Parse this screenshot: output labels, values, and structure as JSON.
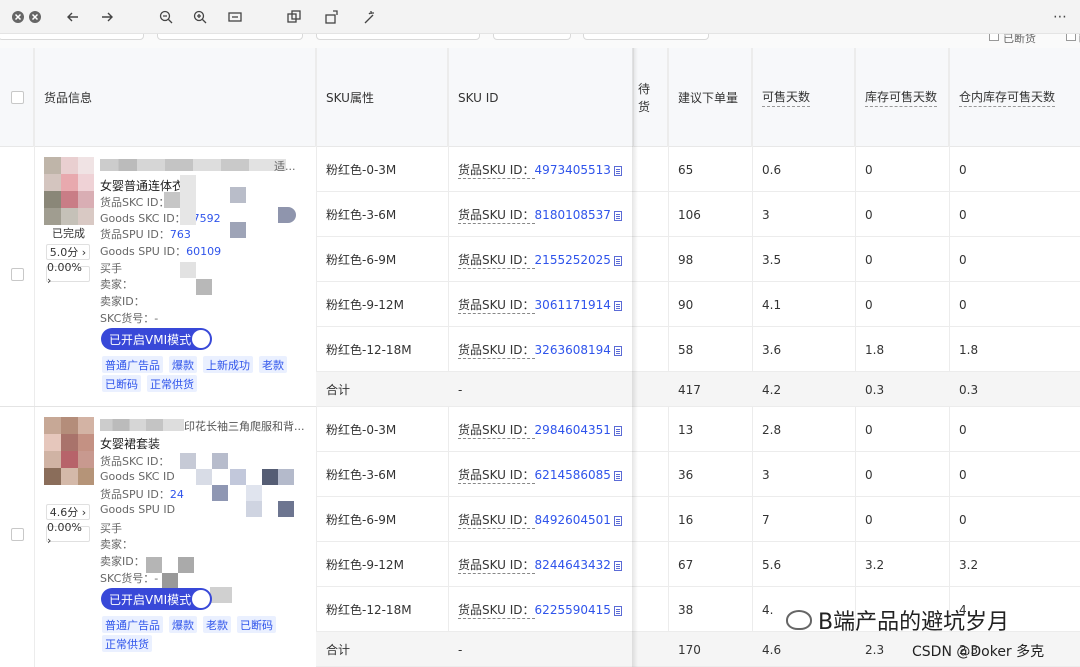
{
  "toolbar": {
    "icons": [
      "close-icon",
      "close-icon",
      "arrow-left-icon",
      "arrow-right-icon",
      "zoom-out-icon",
      "zoom-in-icon",
      "fit-icon",
      "copy-icon",
      "rotate-icon",
      "magic-icon",
      "more-icon"
    ],
    "more_label": "⋯",
    "right_label_1": "已断货",
    "right_label_2": "已"
  },
  "table": {
    "headers": {
      "product_info": "货品信息",
      "sku_attr": "SKU属性",
      "sku_id": "SKU ID",
      "pending": "待\n货",
      "suggested_qty": "建议下单量",
      "sellable_days": "可售天数",
      "stock_sellable_days": "库存可售天数",
      "warehouse_stock_days": "仓内库存可售天数"
    },
    "sku_label": "货品SKU ID：",
    "total_label": "合计",
    "dash": "-",
    "groups": [
      {
        "title_tail": "适...",
        "name": "女婴普通连体衣",
        "skc_id_label": "货品SKC ID：",
        "goods_skc_label": "Goods SKC ID：",
        "goods_skc_value": "17592",
        "spu_label": "货品SPU ID：",
        "spu_value": "763",
        "goods_spu_label": "Goods SPU ID：",
        "goods_spu_value": "60109",
        "buyer_label": "买手",
        "seller_label": "卖家：",
        "seller_id_label": "卖家ID：",
        "skc_no_label": "SKC货号：",
        "skc_no_value": "-",
        "status": "已完成",
        "score": "5.0分 ›",
        "rate": "0.00% ›",
        "vmi": "已开启VMI模式",
        "tags": [
          "普通广告品",
          "爆款",
          "上新成功",
          "老款",
          "已断码",
          "正常供货"
        ],
        "rows": [
          {
            "attr": "粉红色-0-3M",
            "sku": "4973405513",
            "qty": "65",
            "days": "0.6",
            "stock_days": "0",
            "wh_days": "0"
          },
          {
            "attr": "粉红色-3-6M",
            "sku": "8180108537",
            "qty": "106",
            "days": "3",
            "stock_days": "0",
            "wh_days": "0"
          },
          {
            "attr": "粉红色-6-9M",
            "sku": "2155252025",
            "qty": "98",
            "days": "3.5",
            "stock_days": "0",
            "wh_days": "0"
          },
          {
            "attr": "粉红色-9-12M",
            "sku": "3061171914",
            "qty": "90",
            "days": "4.1",
            "stock_days": "0",
            "wh_days": "0"
          },
          {
            "attr": "粉红色-12-18M",
            "sku": "3263608194",
            "qty": "58",
            "days": "3.6",
            "stock_days": "1.8",
            "wh_days": "1.8"
          }
        ],
        "total": {
          "qty": "417",
          "days": "4.2",
          "stock_days": "0.3",
          "wh_days": "0.3"
        }
      },
      {
        "title_tail": "印花长袖三角爬服和背...",
        "name": "女婴裙套装",
        "skc_id_label": "货品SKC ID：",
        "goods_skc_label": "Goods SKC ID",
        "spu_label": "货品SPU ID：",
        "spu_value": "24",
        "goods_spu_label": "Goods SPU ID",
        "buyer_label": "买手",
        "seller_label": "卖家：",
        "seller_id_label": "卖家ID：",
        "skc_no_label": "SKC货号：",
        "skc_no_value": "-",
        "score": "4.6分 ›",
        "rate": "0.00% ›",
        "vmi": "已开启VMI模式",
        "tags": [
          "普通广告品",
          "爆款",
          "老款",
          "已断码",
          "正常供货"
        ],
        "rows": [
          {
            "attr": "粉红色-0-3M",
            "sku": "2984604351",
            "qty": "13",
            "days": "2.8",
            "stock_days": "0",
            "wh_days": "0"
          },
          {
            "attr": "粉红色-3-6M",
            "sku": "6214586085",
            "qty": "36",
            "days": "3",
            "stock_days": "0",
            "wh_days": "0"
          },
          {
            "attr": "粉红色-6-9M",
            "sku": "8492604501",
            "qty": "16",
            "days": "7",
            "stock_days": "0",
            "wh_days": "0"
          },
          {
            "attr": "粉红色-9-12M",
            "sku": "8244643432",
            "qty": "67",
            "days": "5.6",
            "stock_days": "3.2",
            "wh_days": "3.2"
          },
          {
            "attr": "粉红色-12-18M",
            "sku": "6225590415",
            "qty": "38",
            "days": "4.",
            "stock_days": "",
            "wh_days": "4."
          }
        ],
        "total": {
          "qty": "170",
          "days": "4.6",
          "stock_days": "2.3",
          "wh_days": "2.3"
        }
      }
    ]
  },
  "watermark": {
    "text": "B端产品的避坑岁月",
    "csdn": "CSDN @Doker 多克"
  },
  "colors": {
    "accent": "#3848d8",
    "link": "#2f54eb",
    "tag_bg": "#eaf0ff"
  }
}
